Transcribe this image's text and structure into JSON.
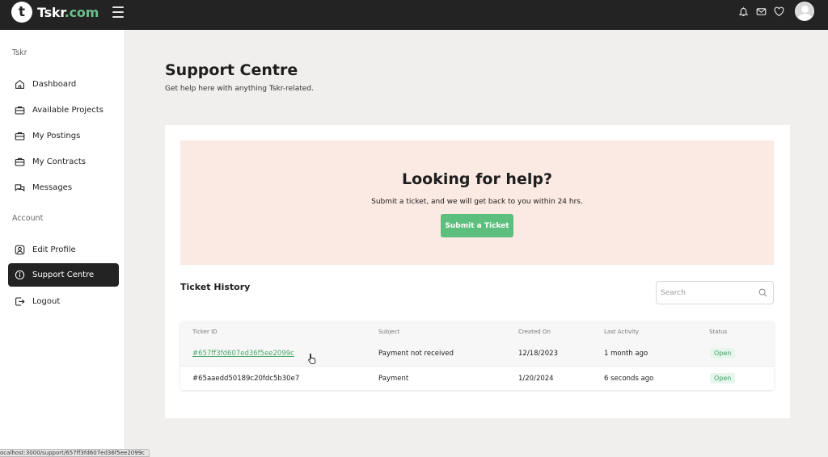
{
  "topbar": {
    "logo_mark": "t",
    "brand_name": "Tskr",
    "brand_tld": ".com"
  },
  "sidebar": {
    "section_main": "Tskr",
    "section_account": "Account",
    "items": [
      {
        "label": "Dashboard",
        "icon": "home-icon"
      },
      {
        "label": "Available Projects",
        "icon": "briefcase-icon"
      },
      {
        "label": "My Postings",
        "icon": "briefcase-icon"
      },
      {
        "label": "My Contracts",
        "icon": "briefcase-icon"
      },
      {
        "label": "Messages",
        "icon": "chat-icon"
      },
      {
        "label": "Edit Profile",
        "icon": "user-icon"
      },
      {
        "label": "Support Centre",
        "icon": "info-icon",
        "active": true
      },
      {
        "label": "Logout",
        "icon": "logout-icon"
      }
    ]
  },
  "page": {
    "title": "Support Centre",
    "subtitle": "Get help here with anything Tskr-related."
  },
  "hero": {
    "title": "Looking for help?",
    "text": "Submit a ticket, and we will get back to you within 24 hrs.",
    "button_label": "Submit a Ticket"
  },
  "history": {
    "title": "Ticket History",
    "search_placeholder": "Search",
    "columns": [
      "Ticker ID",
      "Subject",
      "Created On",
      "Last Activity",
      "Status"
    ],
    "rows": [
      {
        "id": "#657ff3fd607ed36f5ee2099c",
        "subject": "Payment not received",
        "created": "12/18/2023",
        "activity": "1 month ago",
        "status": "Open"
      },
      {
        "id": "#65aaedd50189c20fdc5b30e7",
        "subject": "Payment",
        "created": "1/20/2024",
        "activity": "6 seconds ago",
        "status": "Open"
      }
    ]
  },
  "statusbar": {
    "url": "ocalhost:3000/support/657ff3fd607ed36f5ee2099c"
  },
  "colors": {
    "accent": "#5cbf7d",
    "topbar": "#232323",
    "hero_bg": "#fbe9e3"
  }
}
